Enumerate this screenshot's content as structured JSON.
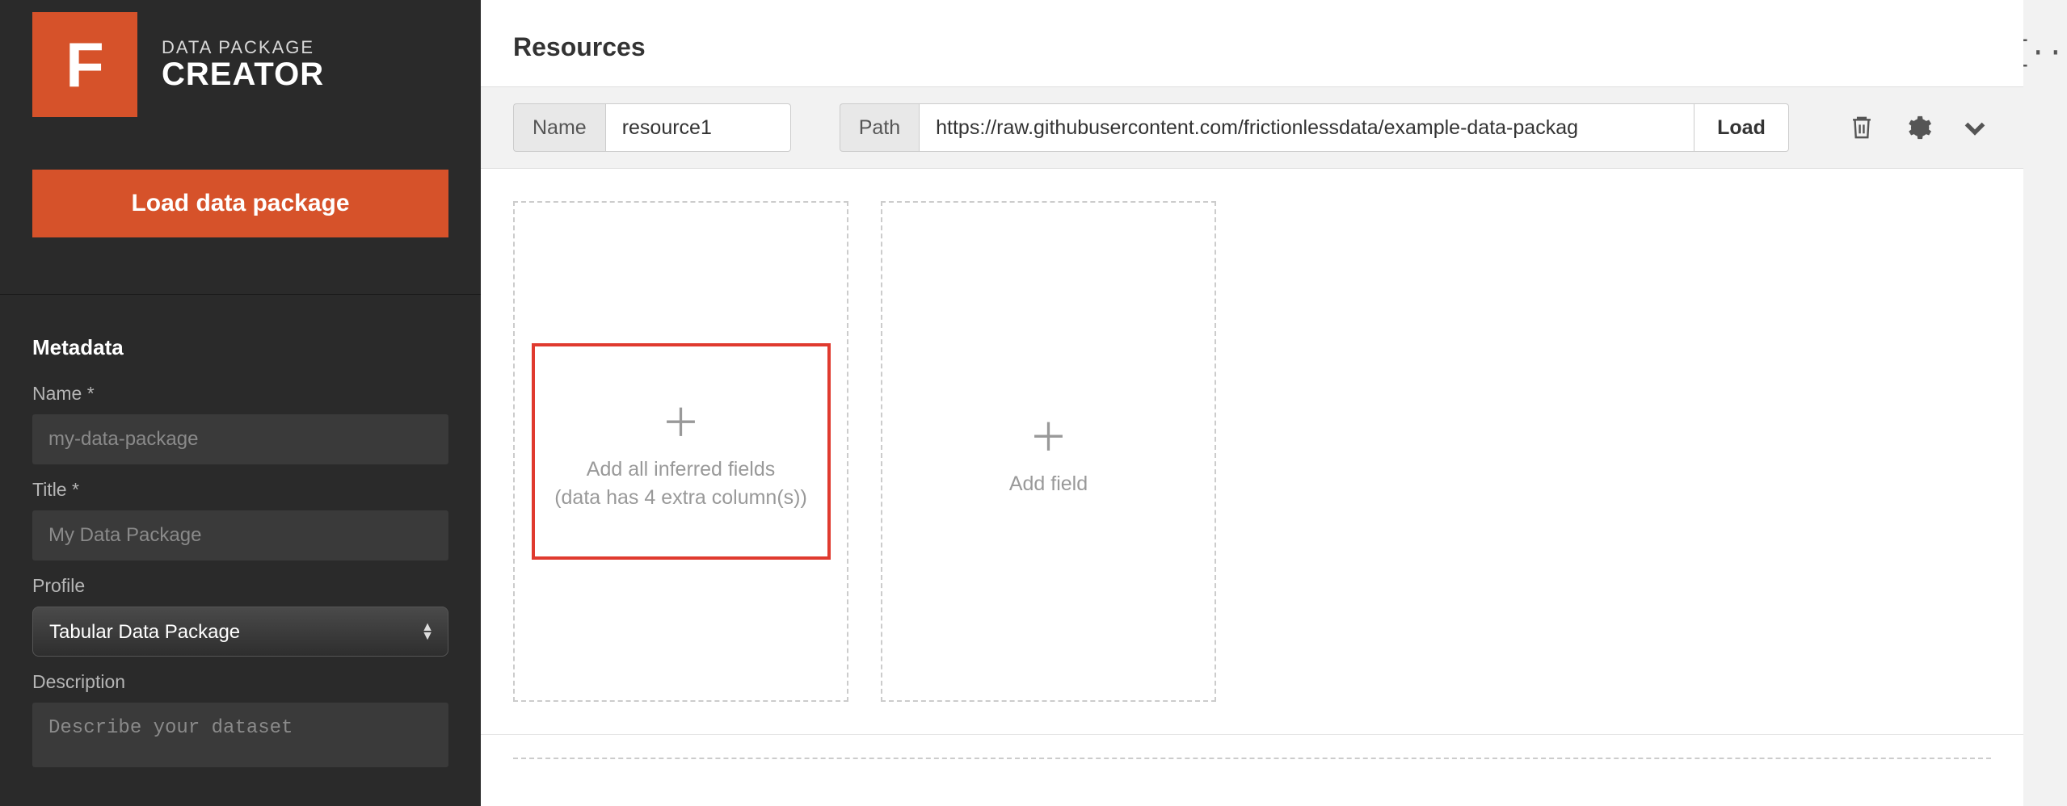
{
  "sidebar": {
    "logo_sub": "DATA PACKAGE",
    "logo_main": "CREATOR",
    "load_button": "Load data package",
    "metadata_title": "Metadata",
    "name_label": "Name *",
    "name_placeholder": "my-data-package",
    "title_label": "Title *",
    "title_placeholder": "My Data Package",
    "profile_label": "Profile",
    "profile_value": "Tabular Data Package",
    "description_label": "Description",
    "description_placeholder": "Describe your dataset"
  },
  "main": {
    "resources_title": "Resources",
    "name_label": "Name",
    "name_value": "resource1",
    "path_label": "Path",
    "path_value": "https://raw.githubusercontent.com/frictionlessdata/example-data-packag",
    "load_label": "Load",
    "inferred_line1": "Add all inferred fields",
    "inferred_line2": "(data has 4 extra column(s))",
    "add_field_label": "Add field"
  },
  "gutter": {
    "json_label": "{···}"
  }
}
